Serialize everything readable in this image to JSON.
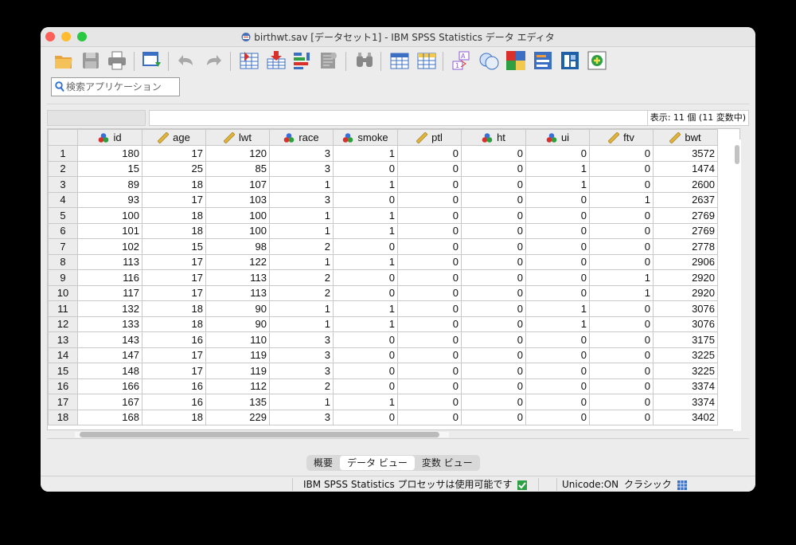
{
  "window": {
    "title": "birthwt.sav [データセット1] - IBM SPSS Statistics データ エディタ"
  },
  "toolbar": {
    "buttons": [
      {
        "name": "open-icon"
      },
      {
        "name": "save-icon"
      },
      {
        "name": "print-icon"
      },
      {
        "name": "recall-dialog-icon"
      },
      {
        "name": "undo-icon"
      },
      {
        "name": "redo-icon"
      },
      {
        "name": "goto-case-icon"
      },
      {
        "name": "goto-variable-icon"
      },
      {
        "name": "variables-icon"
      },
      {
        "name": "run-descriptives-icon"
      },
      {
        "name": "find-icon"
      },
      {
        "name": "insert-cases-icon"
      },
      {
        "name": "insert-variable-icon"
      },
      {
        "name": "split-file-icon"
      },
      {
        "name": "weight-cases-icon"
      },
      {
        "name": "select-cases-icon"
      },
      {
        "name": "value-labels-icon"
      },
      {
        "name": "use-variable-sets-icon"
      },
      {
        "name": "spell-check-icon"
      }
    ]
  },
  "search": {
    "placeholder": "検索アプリケーション"
  },
  "grid": {
    "showing": "表示: 11 個 (11 変数中)",
    "columns": [
      {
        "name": "id",
        "icon": "nominal-icon"
      },
      {
        "name": "age",
        "icon": "scale-icon"
      },
      {
        "name": "lwt",
        "icon": "scale-icon"
      },
      {
        "name": "race",
        "icon": "nominal-icon"
      },
      {
        "name": "smoke",
        "icon": "nominal-icon"
      },
      {
        "name": "ptl",
        "icon": "scale-icon"
      },
      {
        "name": "ht",
        "icon": "nominal-icon"
      },
      {
        "name": "ui",
        "icon": "nominal-icon"
      },
      {
        "name": "ftv",
        "icon": "scale-icon"
      },
      {
        "name": "bwt",
        "icon": "scale-icon"
      }
    ],
    "rows": [
      {
        "n": "1",
        "cells": [
          "180",
          "17",
          "120",
          "3",
          "1",
          "0",
          "0",
          "0",
          "0",
          "3572"
        ]
      },
      {
        "n": "2",
        "cells": [
          "15",
          "25",
          "85",
          "3",
          "0",
          "0",
          "0",
          "1",
          "0",
          "1474"
        ]
      },
      {
        "n": "3",
        "cells": [
          "89",
          "18",
          "107",
          "1",
          "1",
          "0",
          "0",
          "1",
          "0",
          "2600"
        ]
      },
      {
        "n": "4",
        "cells": [
          "93",
          "17",
          "103",
          "3",
          "0",
          "0",
          "0",
          "0",
          "1",
          "2637"
        ]
      },
      {
        "n": "5",
        "cells": [
          "100",
          "18",
          "100",
          "1",
          "1",
          "0",
          "0",
          "0",
          "0",
          "2769"
        ]
      },
      {
        "n": "6",
        "cells": [
          "101",
          "18",
          "100",
          "1",
          "1",
          "0",
          "0",
          "0",
          "0",
          "2769"
        ]
      },
      {
        "n": "7",
        "cells": [
          "102",
          "15",
          "98",
          "2",
          "0",
          "0",
          "0",
          "0",
          "0",
          "2778"
        ]
      },
      {
        "n": "8",
        "cells": [
          "113",
          "17",
          "122",
          "1",
          "1",
          "0",
          "0",
          "0",
          "0",
          "2906"
        ]
      },
      {
        "n": "9",
        "cells": [
          "116",
          "17",
          "113",
          "2",
          "0",
          "0",
          "0",
          "0",
          "1",
          "2920"
        ]
      },
      {
        "n": "10",
        "cells": [
          "117",
          "17",
          "113",
          "2",
          "0",
          "0",
          "0",
          "0",
          "1",
          "2920"
        ]
      },
      {
        "n": "11",
        "cells": [
          "132",
          "18",
          "90",
          "1",
          "1",
          "0",
          "0",
          "1",
          "0",
          "3076"
        ]
      },
      {
        "n": "12",
        "cells": [
          "133",
          "18",
          "90",
          "1",
          "1",
          "0",
          "0",
          "1",
          "0",
          "3076"
        ]
      },
      {
        "n": "13",
        "cells": [
          "143",
          "16",
          "110",
          "3",
          "0",
          "0",
          "0",
          "0",
          "0",
          "3175"
        ]
      },
      {
        "n": "14",
        "cells": [
          "147",
          "17",
          "119",
          "3",
          "0",
          "0",
          "0",
          "0",
          "0",
          "3225"
        ]
      },
      {
        "n": "15",
        "cells": [
          "148",
          "17",
          "119",
          "3",
          "0",
          "0",
          "0",
          "0",
          "0",
          "3225"
        ]
      },
      {
        "n": "16",
        "cells": [
          "166",
          "16",
          "112",
          "2",
          "0",
          "0",
          "0",
          "0",
          "0",
          "3374"
        ]
      },
      {
        "n": "17",
        "cells": [
          "167",
          "16",
          "135",
          "1",
          "1",
          "0",
          "0",
          "0",
          "0",
          "3374"
        ]
      },
      {
        "n": "18",
        "cells": [
          "168",
          "18",
          "229",
          "3",
          "0",
          "0",
          "0",
          "0",
          "0",
          "3402"
        ]
      }
    ]
  },
  "tabs": [
    "概要",
    "データ ビュー",
    "変数 ビュー"
  ],
  "active_tab": 1,
  "status": {
    "processor": "IBM SPSS Statistics プロセッサは使用可能です",
    "unicode": "Unicode:ON",
    "mode": "クラシック"
  },
  "colors": {
    "nominal_red": "#d9302c",
    "nominal_green": "#2e9e3c",
    "nominal_blue": "#3a6fd8",
    "scale_ruler": "#e0b43a"
  }
}
